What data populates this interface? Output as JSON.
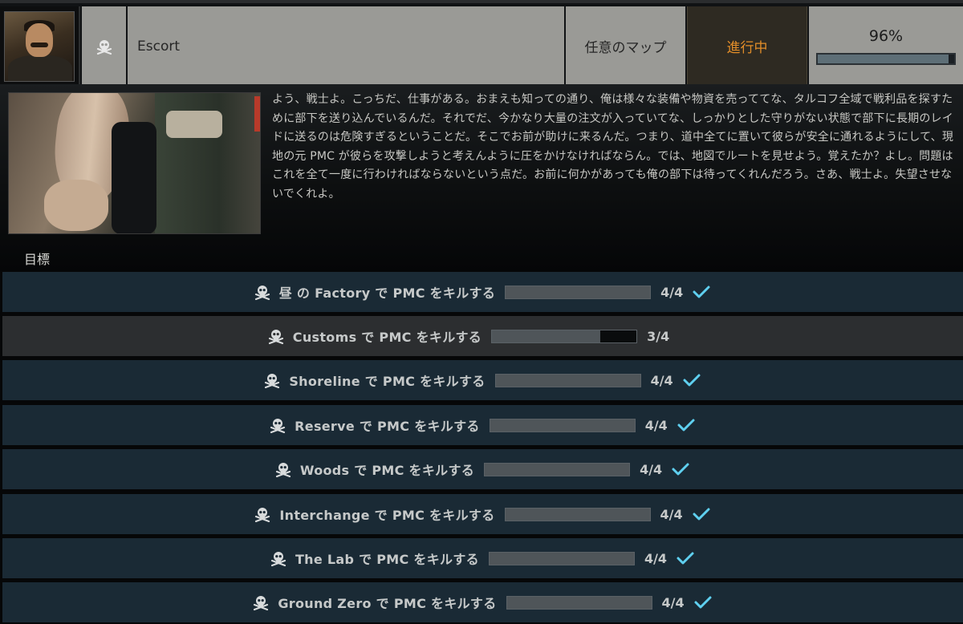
{
  "quest": {
    "type_icon": "skull-icon",
    "name": "Escort",
    "map": "任意のマップ",
    "status": "進行中",
    "progress_text": "96%",
    "progress": 0.96,
    "status_color": "#e28d29"
  },
  "description": {
    "text": "よう、戦士よ。こっちだ、仕事がある。おまえも知っての通り、俺は様々な装備や物資を売っててな、タルコフ全域で戦利品を探すために部下を送り込んでいるんだ。それでだ、今かなり大量の注文が入っていてな、しっかりとした守りがない状態で部下に長期のレイドに送るのは危険すぎるということだ。そこでお前が助けに来るんだ。つまり、道中全てに置いて彼らが安全に通れるようにして、現地の元 PMC が彼らを攻撃しようと考えんように圧をかけなければならん。では、地図でルートを見せよう。覚えたか？よし。問題はこれを全て一度に行わければならないという点だ。お前に何かがあっても俺の部下は待ってくれんだろう。さあ、戦士よ。失望させないでくれよ。"
  },
  "objectives_label": "目標",
  "objectives": [
    {
      "text": "昼 の Factory で PMC をキルする",
      "count": "4/4",
      "current": 4,
      "total": 4,
      "complete": true
    },
    {
      "text": "Customs で PMC をキルする",
      "count": "3/4",
      "current": 3,
      "total": 4,
      "complete": false
    },
    {
      "text": "Shoreline で PMC をキルする",
      "count": "4/4",
      "current": 4,
      "total": 4,
      "complete": true
    },
    {
      "text": "Reserve で PMC をキルする",
      "count": "4/4",
      "current": 4,
      "total": 4,
      "complete": true
    },
    {
      "text": "Woods で PMC をキルする",
      "count": "4/4",
      "current": 4,
      "total": 4,
      "complete": true
    },
    {
      "text": "Interchange で PMC をキルする",
      "count": "4/4",
      "current": 4,
      "total": 4,
      "complete": true
    },
    {
      "text": "The Lab で PMC をキルする",
      "count": "4/4",
      "current": 4,
      "total": 4,
      "complete": true
    },
    {
      "text": "Ground Zero で PMC をキルする",
      "count": "4/4",
      "current": 4,
      "total": 4,
      "complete": true
    }
  ],
  "colors": {
    "row_complete": "#1a2a35",
    "row_incomplete": "#2c2e30",
    "check": "#5fd0f0"
  }
}
